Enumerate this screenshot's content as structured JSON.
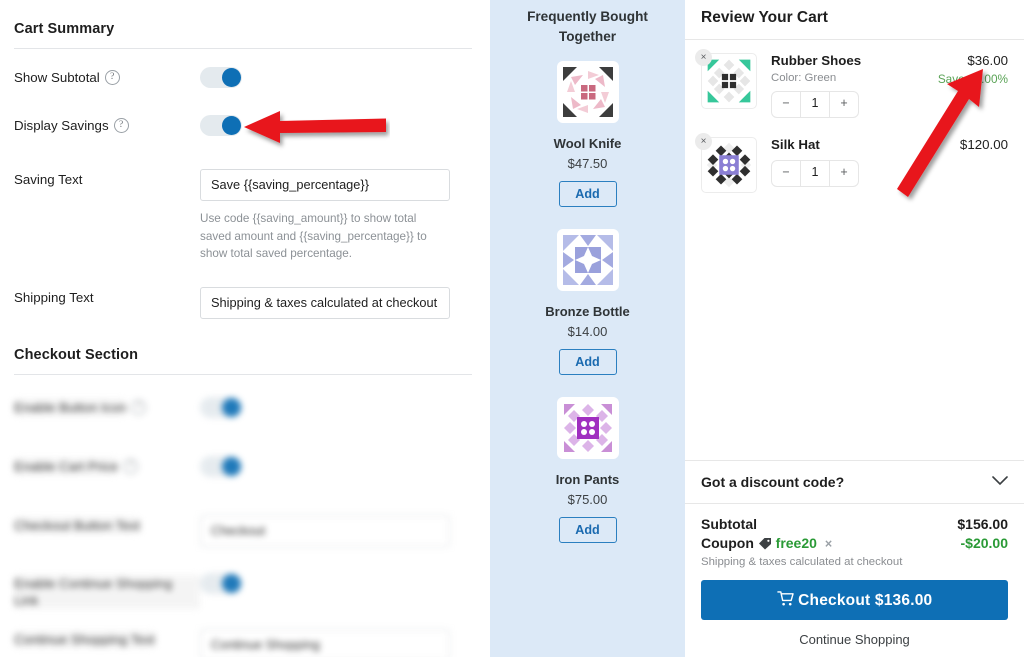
{
  "settings": {
    "sections": [
      {
        "title": "Cart Summary",
        "fields": [
          {
            "label": "Show Subtotal",
            "type": "toggle",
            "help": "?",
            "value": "on"
          },
          {
            "label": "Display Savings",
            "type": "toggle",
            "help": "?",
            "value": "on"
          },
          {
            "label": "Saving Text",
            "type": "text",
            "value": "Save {{saving_percentage}}",
            "description": "Use code {{saving_amount}} to show total saved amount and {{saving_percentage}} to show total saved percentage."
          },
          {
            "label": "Shipping Text",
            "type": "text",
            "value": "Shipping & taxes calculated at checkout"
          }
        ]
      },
      {
        "title": "Checkout Section",
        "fields": [
          {
            "label": "Enable Button Icon",
            "type": "toggle",
            "help": "?",
            "value": "on"
          },
          {
            "label": "Enable Cart Price",
            "type": "toggle",
            "help": "?",
            "value": "on"
          },
          {
            "label": "Checkout Button Text",
            "type": "text",
            "value": "Checkout"
          },
          {
            "label": "Enable Continue Shopping Link",
            "type": "toggle",
            "value": "on"
          },
          {
            "label": "Continue Shopping Text",
            "type": "text",
            "value": "Continue Shopping"
          }
        ]
      }
    ]
  },
  "fbt": {
    "title": "Frequently Bought Together",
    "add_label": "Add",
    "items": [
      {
        "name": "Wool Knife",
        "price": "$47.50",
        "image": "placeholder-pattern-pink"
      },
      {
        "name": "Bronze Bottle",
        "price": "$14.00",
        "image": "placeholder-pattern-blue"
      },
      {
        "name": "Iron Pants",
        "price": "$75.00",
        "image": "placeholder-pattern-purple"
      }
    ]
  },
  "cart": {
    "title": "Review Your Cart",
    "items": [
      {
        "name": "Rubber Shoes",
        "variant": "Color: Green",
        "price": "$36.00",
        "savings": "Save 10.00%",
        "quantity": "1",
        "decrement": "−",
        "increment": "+",
        "remove": "×",
        "image": "placeholder-pattern-green"
      },
      {
        "name": "Silk Hat",
        "variant": "",
        "price": "$120.00",
        "savings": "",
        "quantity": "1",
        "decrement": "−",
        "increment": "+",
        "remove": "×",
        "image": "placeholder-pattern-violet"
      }
    ],
    "discount": {
      "label": "Got a discount code?",
      "chevron": "chevron-down-icon"
    },
    "summary": {
      "subtotal_label": "Subtotal",
      "subtotal_value": "$156.00",
      "coupon_label": "Coupon",
      "coupon_code": "free20",
      "coupon_remove": "×",
      "coupon_value": "-$20.00",
      "shipping_note": "Shipping & taxes calculated at checkout"
    },
    "checkout_label": "Checkout",
    "checkout_total": "$136.00",
    "continue_label": "Continue Shopping"
  },
  "annotations": {
    "arrow_color": "#e8141c",
    "arrows": [
      {
        "name": "arrow-display-savings-toggle"
      },
      {
        "name": "arrow-save-percentage-label"
      }
    ]
  },
  "colors": {
    "accent_blue": "#0e6fb5",
    "fbt_background": "#dce9f7",
    "savings_green": "#5aa356",
    "coupon_green": "#2a9a36",
    "arrow_red": "#e8141c"
  }
}
